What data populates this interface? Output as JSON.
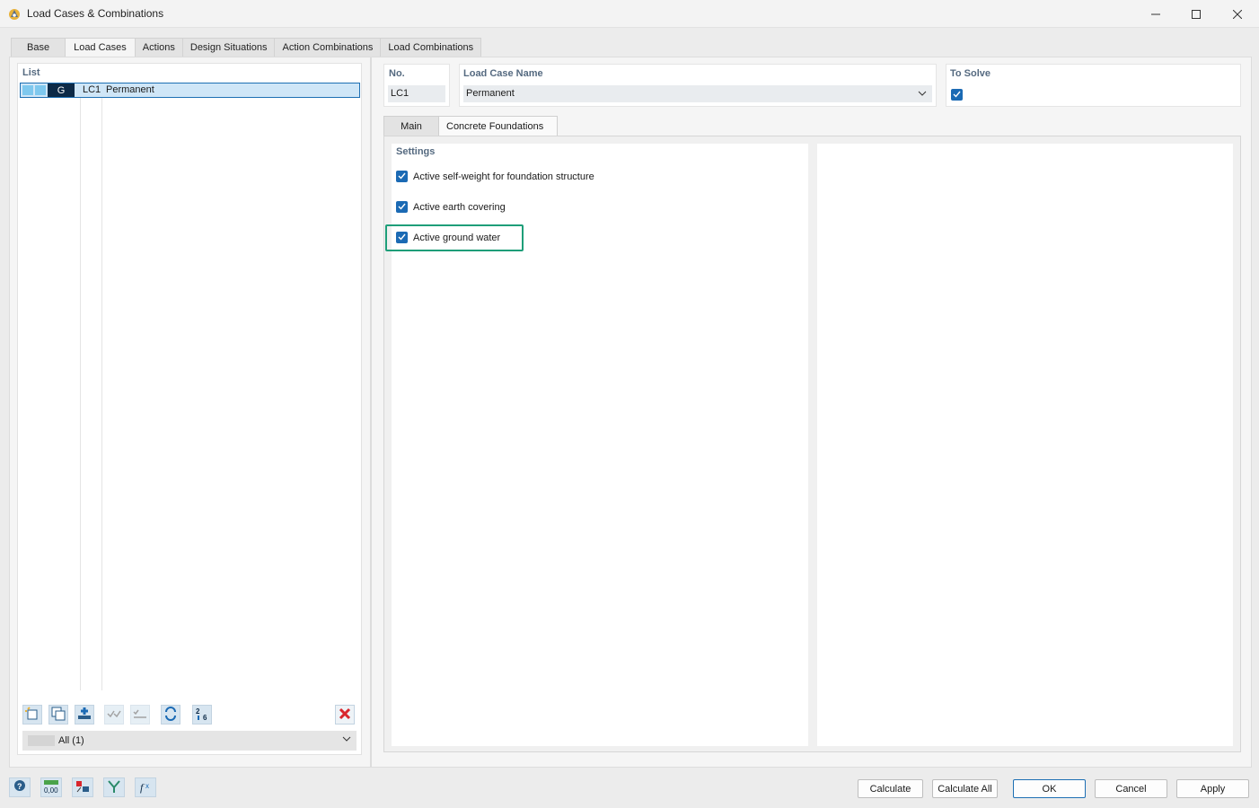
{
  "window": {
    "title": "Load Cases & Combinations"
  },
  "main_tabs": [
    "Base",
    "Load Cases",
    "Actions",
    "Design Situations",
    "Action Combinations",
    "Load Combinations"
  ],
  "list": {
    "label": "List",
    "rows": [
      {
        "type": "G",
        "id": "LC1",
        "name": "Permanent"
      }
    ],
    "filter": "All (1)"
  },
  "header": {
    "no_label": "No.",
    "no_value": "LC1",
    "name_label": "Load Case Name",
    "name_value": "Permanent",
    "solve_label": "To Solve",
    "solve_checked": true
  },
  "sub_tabs": [
    "Main",
    "Concrete Foundations"
  ],
  "settings": {
    "label": "Settings",
    "options": [
      {
        "label": "Active self-weight for foundation structure",
        "checked": true
      },
      {
        "label": "Active earth covering",
        "checked": true
      },
      {
        "label": "Active ground water",
        "checked": true
      }
    ]
  },
  "buttons": {
    "calculate": "Calculate",
    "calculate_all": "Calculate All",
    "ok": "OK",
    "cancel": "Cancel",
    "apply": "Apply"
  },
  "icons": {
    "list_toolbar": [
      "new-icon",
      "copy-icon",
      "insert-icon",
      "check-all-icon",
      "uncheck-all-icon",
      "renumber-icon",
      "sort-icon",
      "delete-icon"
    ],
    "footer": [
      "help-icon",
      "units-icon",
      "display-icon",
      "filter-icon",
      "formula-icon"
    ]
  },
  "colors": {
    "accent": "#1b6ab4",
    "highlight": "#1e9e79",
    "delete": "#d9262d",
    "type_g": "#0d2a47"
  }
}
